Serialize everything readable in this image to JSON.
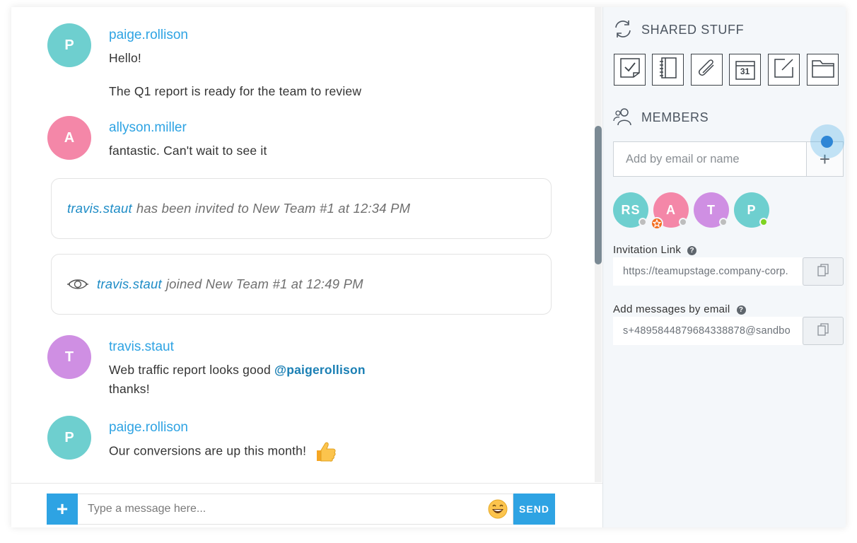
{
  "colors": {
    "accent": "#2ea3e3",
    "avatar_p": "#6ecfcf",
    "avatar_a": "#f487a8",
    "avatar_t": "#cf8fe3",
    "online": "#7ed321",
    "offline": "#bdbdbd"
  },
  "messages": [
    {
      "initial": "P",
      "author": "paige.rollison",
      "lines": [
        "Hello!",
        "The Q1 report is ready for the team to review"
      ]
    },
    {
      "initial": "A",
      "author": "allyson.miller",
      "lines": [
        "fantastic. Can't wait to see it"
      ]
    },
    {
      "initial": "T",
      "author": "travis.staut",
      "text_before_mention": "Web traffic report looks good",
      "mention": "@paigerollison",
      "line2": "thanks!"
    },
    {
      "initial": "P",
      "author": "paige.rollison",
      "lines": [
        "Our conversions are up this month!"
      ],
      "emoji_icon": "thumbs-up-icon"
    }
  ],
  "notices": [
    {
      "user": "travis.staut",
      "text": "has been invited to New Team #1 at 12:34 PM"
    },
    {
      "user": "travis.staut",
      "text": "joined New Team #1 at 12:49 PM",
      "icon": "eye-icon"
    }
  ],
  "composer": {
    "placeholder": "Type a message here...",
    "plus_label": "+",
    "send_label": "SEND"
  },
  "panel": {
    "shared_title": "SHARED STUFF",
    "shared_tiles": [
      "tasks-icon",
      "notebook-icon",
      "attachment-icon",
      "calendar-icon",
      "note-icon",
      "folder-icon"
    ],
    "calendar_day": "31",
    "members_title": "MEMBERS",
    "add_placeholder": "Add by email or name",
    "add_label": "+",
    "members": [
      {
        "initials": "RS",
        "status": "offline"
      },
      {
        "initials": "A",
        "status": "offline",
        "owner": true
      },
      {
        "initials": "T",
        "status": "offline"
      },
      {
        "initials": "P",
        "status": "online"
      }
    ],
    "invitation_label": "Invitation Link",
    "invitation_value": "https://teamupstage.company-corp.",
    "email_label": "Add messages by email",
    "email_value": "s+4895844879684338878@sandbo",
    "help_glyph": "?"
  }
}
